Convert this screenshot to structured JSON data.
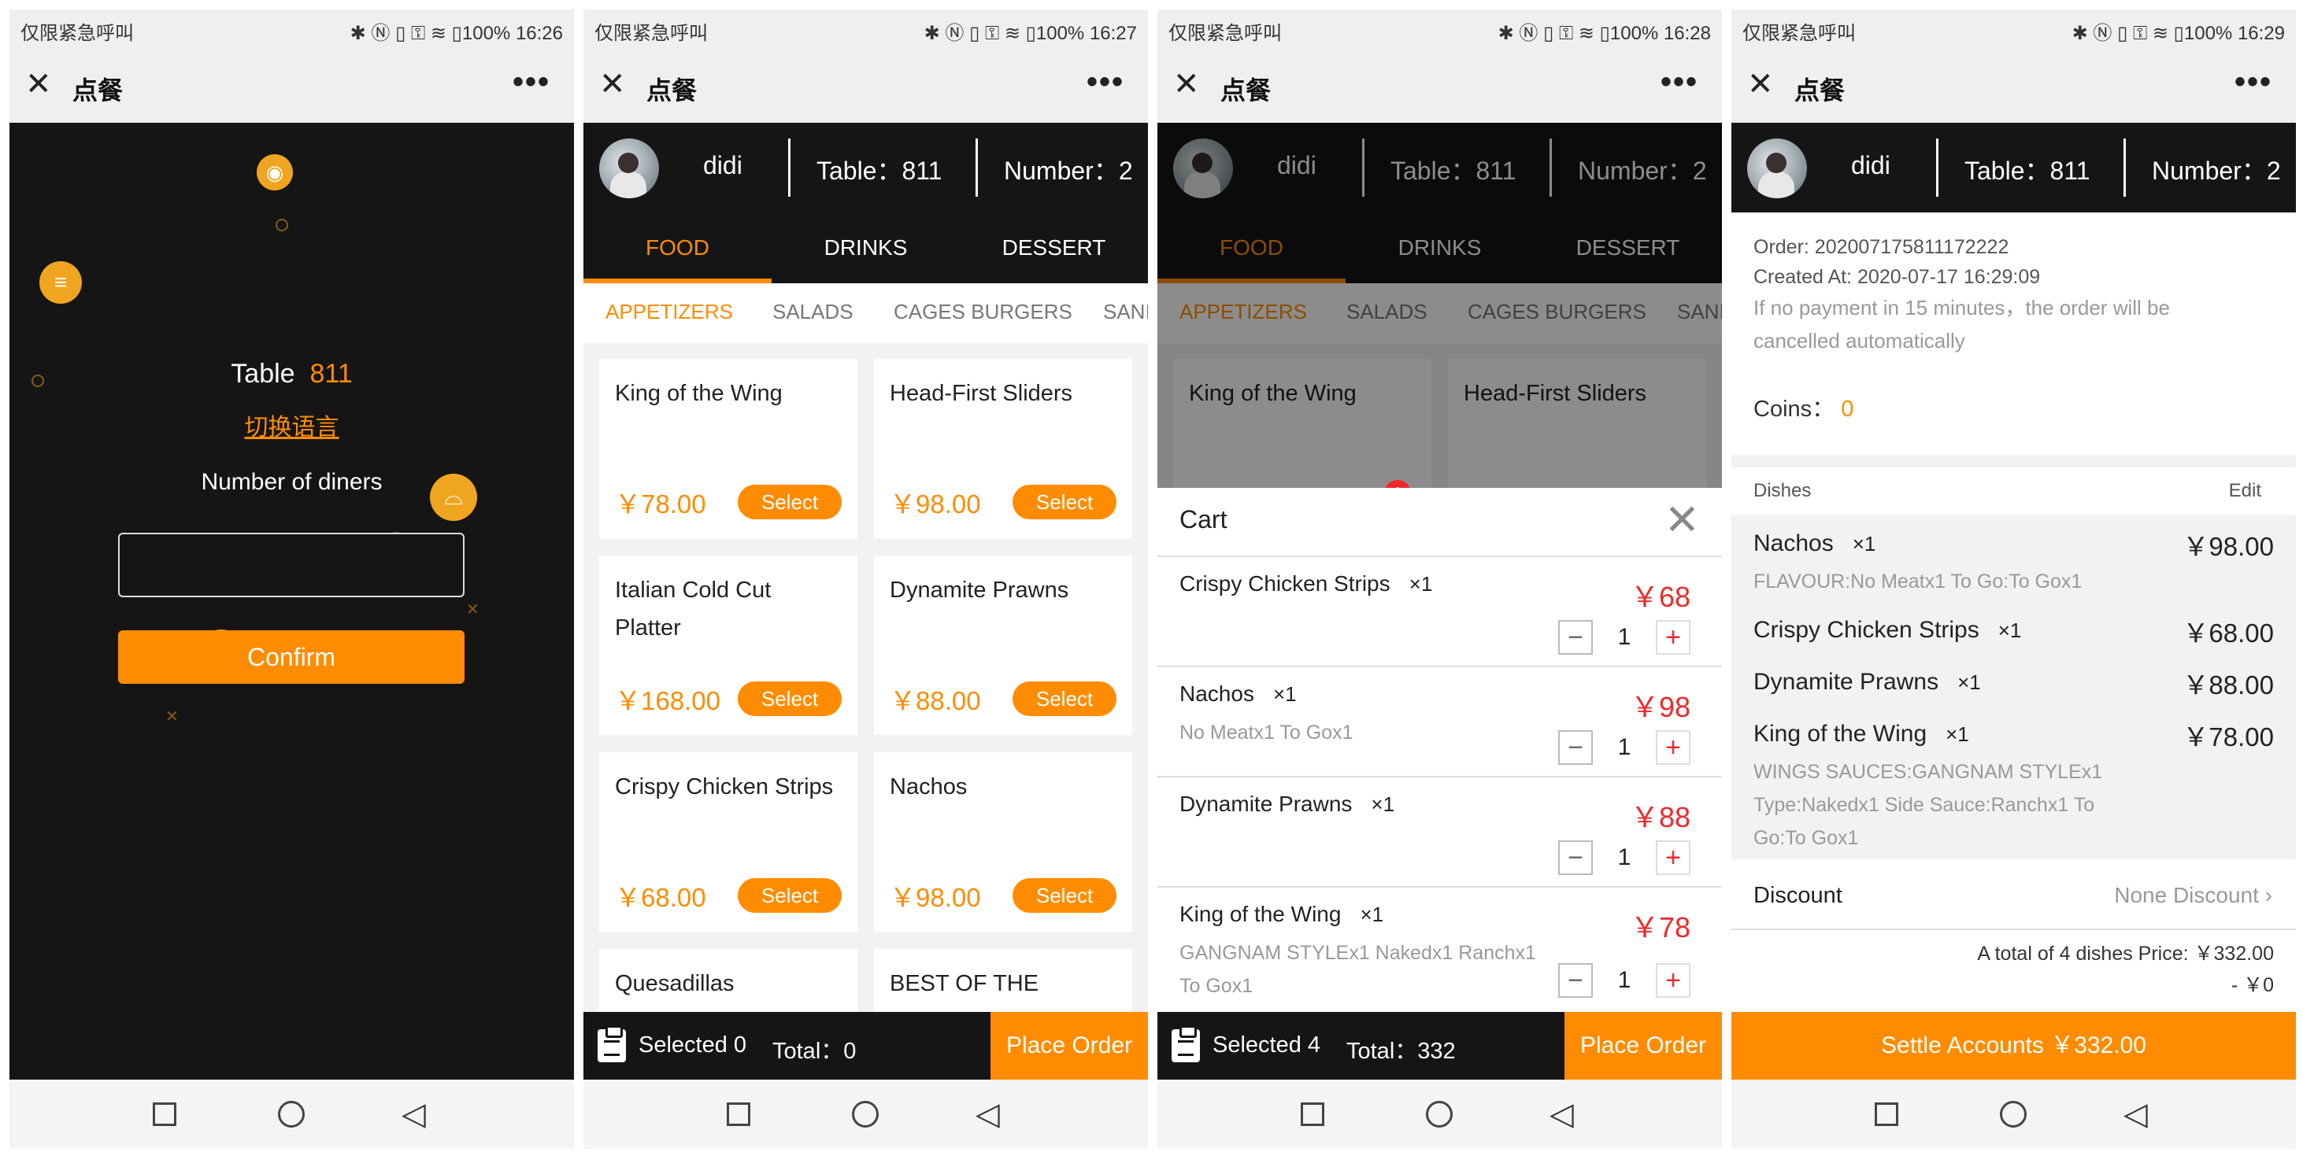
{
  "statusbar": {
    "left_text": "仅限紧急呼叫",
    "right_prefix": "✱ Ⓝ ▯ ⚿ ≋ ▯100%",
    "times": [
      "16:26",
      "16:27",
      "16:28",
      "16:29"
    ]
  },
  "app": {
    "title": "点餐",
    "close_glyph": "✕",
    "more_glyph": "•••"
  },
  "screen1": {
    "table_label": "Table",
    "table_number": "811",
    "switch_language": "切换语言",
    "diners_label": "Number of diners",
    "diners_value": "",
    "confirm": "Confirm"
  },
  "header": {
    "user_name": "didi",
    "table": "Table：811",
    "number": "Number：2"
  },
  "categories": [
    "FOOD",
    "DRINKS",
    "DESSERT"
  ],
  "subcategories": [
    "APPETIZERS",
    "SALADS",
    "CAGES BURGERS",
    "SANI"
  ],
  "menu_items": [
    {
      "name": "King of the Wing",
      "price": "￥78.00",
      "select": "Select"
    },
    {
      "name": "Head-First Sliders",
      "price": "￥98.00",
      "select": "Select"
    },
    {
      "name": "Italian Cold Cut Platter",
      "price": "￥168.00",
      "select": "Select"
    },
    {
      "name": "Dynamite Prawns",
      "price": "￥88.00",
      "select": "Select"
    },
    {
      "name": "Crispy Chicken Strips",
      "price": "￥68.00",
      "select": "Select"
    },
    {
      "name": "Nachos",
      "price": "￥98.00",
      "select": "Select"
    },
    {
      "name": "Quesadillas"
    },
    {
      "name": "BEST OF THE"
    }
  ],
  "bottom2": {
    "selected": "Selected 0",
    "total": "Total：0",
    "place_order": "Place Order"
  },
  "bottom3": {
    "selected": "Selected 4",
    "total": "Total：332",
    "place_order": "Place Order"
  },
  "cart_badge": "1",
  "cart": {
    "title": "Cart",
    "items": [
      {
        "name": "Crispy Chicken Strips",
        "qty_label": "×1",
        "desc": "",
        "price": "￥68",
        "qty": "1"
      },
      {
        "name": "Nachos",
        "qty_label": "×1",
        "desc": "No Meatx1 To Gox1",
        "price": "￥98",
        "qty": "1"
      },
      {
        "name": "Dynamite Prawns",
        "qty_label": "×1",
        "desc": "",
        "price": "￥88",
        "qty": "1"
      },
      {
        "name": "King of the Wing",
        "qty_label": "×1",
        "desc": "GANGNAM STYLEx1 Nakedx1 Ranchx1 To Gox1",
        "price": "￥78",
        "qty": "1"
      }
    ]
  },
  "order": {
    "order_no": "Order:   202007175811172222",
    "created": "Created At:   2020-07-17 16:29:09",
    "note": "If no payment in 15 minutes，the order will be cancelled automatically",
    "coins_label": "Coins：",
    "coins_value": "0",
    "dishes_label": "Dishes",
    "edit_label": "Edit",
    "dishes": [
      {
        "name": "Nachos",
        "qty": "×1",
        "price": "￥98.00",
        "desc": "FLAVOUR:No Meatx1 To Go:To Gox1"
      },
      {
        "name": "Crispy Chicken Strips",
        "qty": "×1",
        "price": "￥68.00",
        "desc": ""
      },
      {
        "name": "Dynamite Prawns",
        "qty": "×1",
        "price": "￥88.00",
        "desc": ""
      },
      {
        "name": "King of the Wing",
        "qty": "×1",
        "price": "￥78.00",
        "desc": "WINGS SAUCES:GANGNAM STYLEx1 Type:Nakedx1 Side Sauce:Ranchx1 To Go:To Gox1"
      }
    ],
    "discount_label": "Discount",
    "discount_value": "None Discount ›",
    "summary": "A total of 4 dishes   Price:  ￥332.00",
    "minus": "- ￥0",
    "settle": "Settle Accounts ￥332.00"
  },
  "colors": {
    "accent": "#ff8c00",
    "dark": "#151515",
    "price_red": "#f0282d"
  },
  "icons": [
    "close-icon",
    "more-icon",
    "clipboard-icon",
    "minus-icon",
    "plus-icon",
    "chevron-right-icon",
    "square-nav-icon",
    "circle-nav-icon",
    "triangle-back-icon"
  ]
}
